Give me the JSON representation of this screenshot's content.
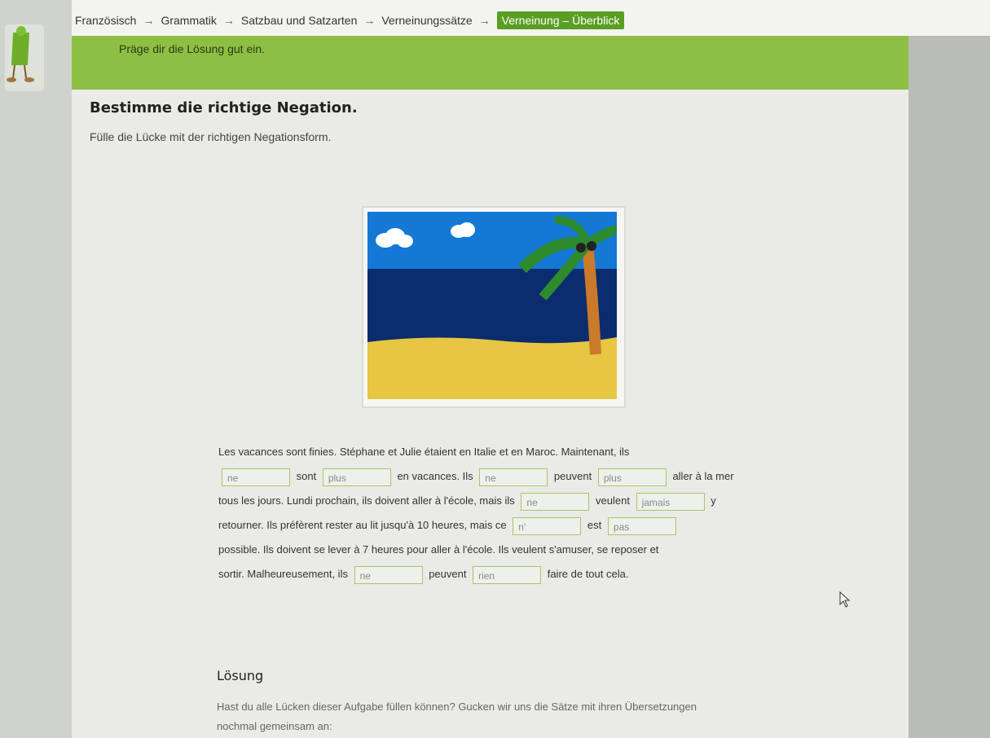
{
  "breadcrumb": {
    "items": [
      "Französisch",
      "Grammatik",
      "Satzbau und Satzarten",
      "Verneinungssätze"
    ],
    "current": "Verneinung – Überblick",
    "separator": "→"
  },
  "banner": {
    "text": "Präge dir die Lösung gut ein."
  },
  "task": {
    "title": "Bestimme die richtige Negation.",
    "instruction": "Fülle die Lücke mit der richtigen Negationsform."
  },
  "exercise": {
    "line1": "Les vacances sont finies. Stéphane et Julie étaient en Italie et en Maroc. Maintenant, ils",
    "line2": {
      "t1": "sont",
      "t2": "en vacances. Ils",
      "t3": "peuvent",
      "t4": "aller à la mer"
    },
    "line3": {
      "t1": "tous les jours. Lundi prochain, ils doivent aller à l'école, mais ils",
      "t2": "veulent",
      "t3": "y"
    },
    "line4": {
      "t1": "retourner. Ils préfèrent rester au lit jusqu'à 10 heures, mais ce",
      "t2": "est"
    },
    "line5": "possible. Ils doivent se lever à 7 heures pour aller à l'école. Ils veulent s'amuser, se reposer et",
    "line6": {
      "t1": "sortir. Malheureusement, ils",
      "t2": "peuvent",
      "t3": "faire de tout cela."
    },
    "gaps": [
      "ne",
      "plus",
      "ne",
      "plus",
      "ne",
      "jamais",
      "n'",
      "pas",
      "ne",
      "rien"
    ]
  },
  "solution": {
    "title": "Lösung",
    "text": "Hast du alle Lücken dieser Aufgabe füllen können? Gucken wir uns die Sätze mit ihren Übersetzungen nochmal gemeinsam an:"
  },
  "colors": {
    "accent": "#8dbf45",
    "badge": "#5a9e23",
    "gap_border": "#a9c46b"
  },
  "icons": {
    "mascot": "mascot-figure",
    "cursor": "mouse-cursor-icon"
  }
}
